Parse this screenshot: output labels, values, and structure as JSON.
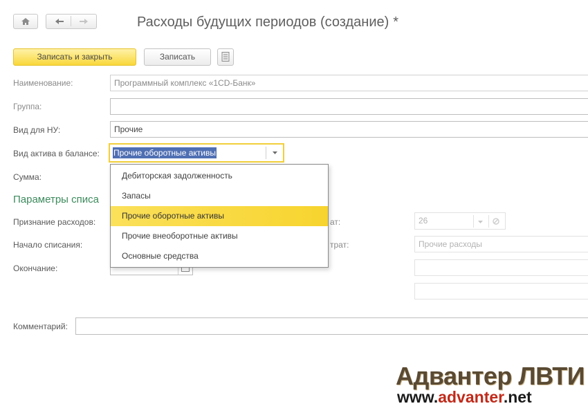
{
  "window": {
    "title": "Расходы будущих периодов (создание)",
    "modified_mark": "*"
  },
  "toolbar": {
    "save_close_label": "Записать и закрыть",
    "save_label": "Записать"
  },
  "fields": {
    "name_label": "Наименование:",
    "name_value": "Программный комплекс «1CD-Банк»",
    "group_label": "Группа:",
    "group_value": "",
    "nu_type_label": "Вид для НУ:",
    "nu_type_value": "Прочие",
    "asset_type_label": "Вид актива в балансе:",
    "asset_type_value": "Прочие оборотные активы",
    "sum_label": "Сумма:"
  },
  "section": {
    "params_title": "Параметры списа",
    "recognition_label": "Признание расходов:",
    "start_label": "Начало списания:",
    "end_label": "Окончание:",
    "right_label_1": "ат:",
    "right_value_1": "26",
    "right_label_2": "трат:",
    "right_value_2": "Прочие расходы"
  },
  "dropdown": {
    "options": [
      "Дебиторская задолженность",
      "Запасы",
      "Прочие оборотные активы",
      "Прочие внеоборотные активы",
      "Основные средства"
    ],
    "selected_index": 2
  },
  "comment": {
    "label": "Комментарий:",
    "value": ""
  },
  "watermark": {
    "brand": "Адвантер ЛВТИ",
    "site_prefix": "www.",
    "site_accent": "advanter",
    "site_suffix": ".net"
  },
  "icons": {
    "home": "home-icon",
    "back": "arrow-left-icon",
    "forward": "arrow-right-icon",
    "list": "document-list-icon",
    "dropdown": "chevron-down-icon",
    "clear": "link-icon"
  },
  "colors": {
    "primary_button": "#f9d73a",
    "selection": "#4f6fb3",
    "section_title": "#3c8a5c",
    "dropdown_highlight": "#f7d42e"
  }
}
